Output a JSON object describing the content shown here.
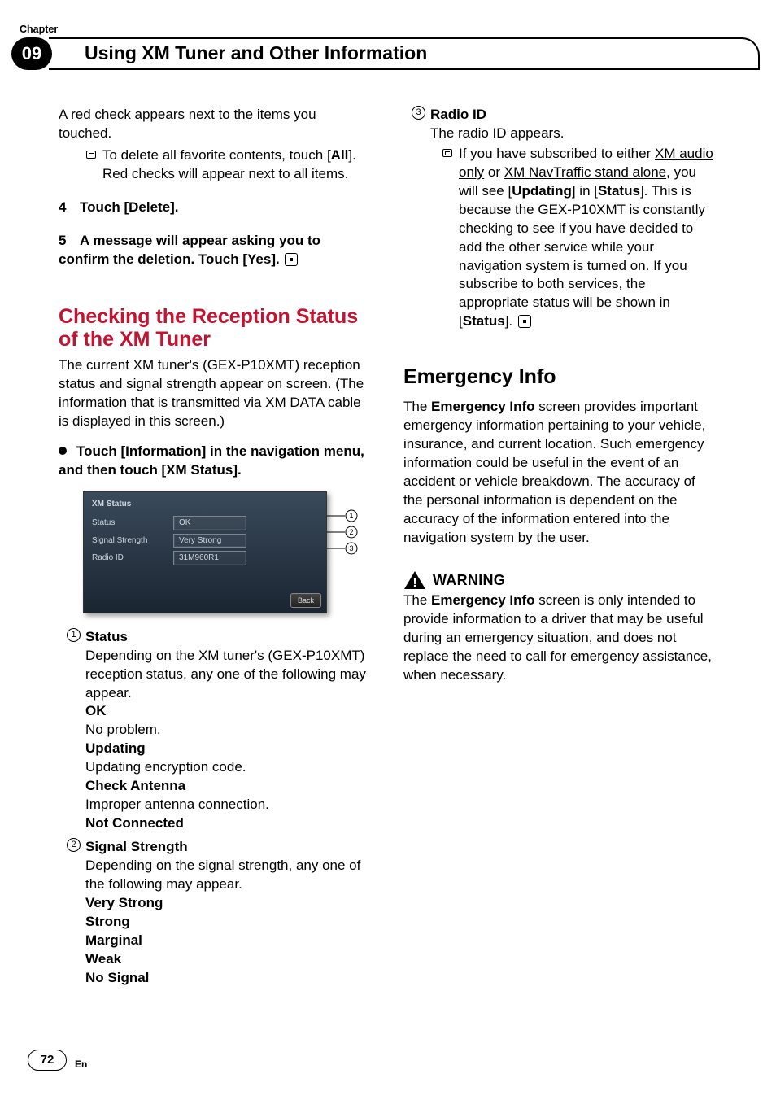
{
  "chapter_label": "Chapter",
  "chapter_number": "09",
  "title": "Using XM Tuner and Other Information",
  "left": {
    "intro1": "A red check appears next to the items you touched.",
    "b1a": "To delete all favorite contents, touch [",
    "b1b": "All",
    "b1c": "]. Red checks will appear next to all items.",
    "step4_num": "4",
    "step4": "Touch [Delete].",
    "step5_num": "5",
    "step5a": "A message will appear asking you to confirm the deletion. Touch [Yes].",
    "h2": "Checking the Reception Status of the XM Tuner",
    "p2": "The current XM tuner's (GEX-P10XMT) reception status and signal strength appear on screen. (The information that is transmitted via XM DATA cable is displayed in this screen.)",
    "dotstep": "Touch [Information] in the navigation menu, and then touch [XM Status].",
    "screenshot": {
      "title": "XM Status",
      "rows": [
        {
          "label": "Status",
          "value": "OK"
        },
        {
          "label": "Signal Strength",
          "value": "Very Strong"
        },
        {
          "label": "Radio ID",
          "value": "31M960R1"
        }
      ],
      "back": "Back"
    },
    "item1": {
      "title": "Status",
      "desc": "Depending on the XM tuner's (GEX-P10XMT) reception status, any one of the following may appear.",
      "ok_t": "OK",
      "ok_d": "No problem.",
      "upd_t": "Updating",
      "upd_d": "Updating encryption code.",
      "chk_t": "Check Antenna",
      "chk_d": "Improper antenna connection.",
      "nc_t": "Not Connected"
    },
    "item2": {
      "title": "Signal Strength",
      "desc": "Depending on the signal strength, any one of the following may appear.",
      "vals": [
        "Very Strong",
        "Strong",
        "Marginal",
        "Weak",
        "No Signal"
      ]
    }
  },
  "right": {
    "item3": {
      "title": "Radio ID",
      "desc": "The radio ID appears.",
      "b_a": "If you have subscribed to either ",
      "b_u1": "XM audio only",
      "b_b": " or ",
      "b_u2": "XM NavTraffic stand alone",
      "b_c": ", you will see [",
      "b_d": "Updating",
      "b_e": "] in [",
      "b_f": "Status",
      "b_g": "]. This is because the GEX-P10XMT is constantly checking to see if you have decided to add the other service while your navigation system is turned on. If you subscribe to both services, the appropriate status will be shown in [",
      "b_h": "Status",
      "b_i": "]."
    },
    "h2": "Emergency Info",
    "p1a": "The ",
    "p1b": "Emergency Info",
    "p1c": " screen provides important emergency information pertaining to your vehicle, insurance, and current location. Such emergency information could be useful in the event of an accident or vehicle breakdown. The accuracy of the personal information is dependent on the accuracy of the information entered into the navigation system by the user.",
    "warn_title": "WARNING",
    "warn_a": "The ",
    "warn_b": "Emergency Info",
    "warn_c": " screen is only intended to provide information to a driver that may be useful during an emergency situation, and does not replace the need to call for emergency assistance, when necessary."
  },
  "page_number": "72",
  "page_lang": "En"
}
